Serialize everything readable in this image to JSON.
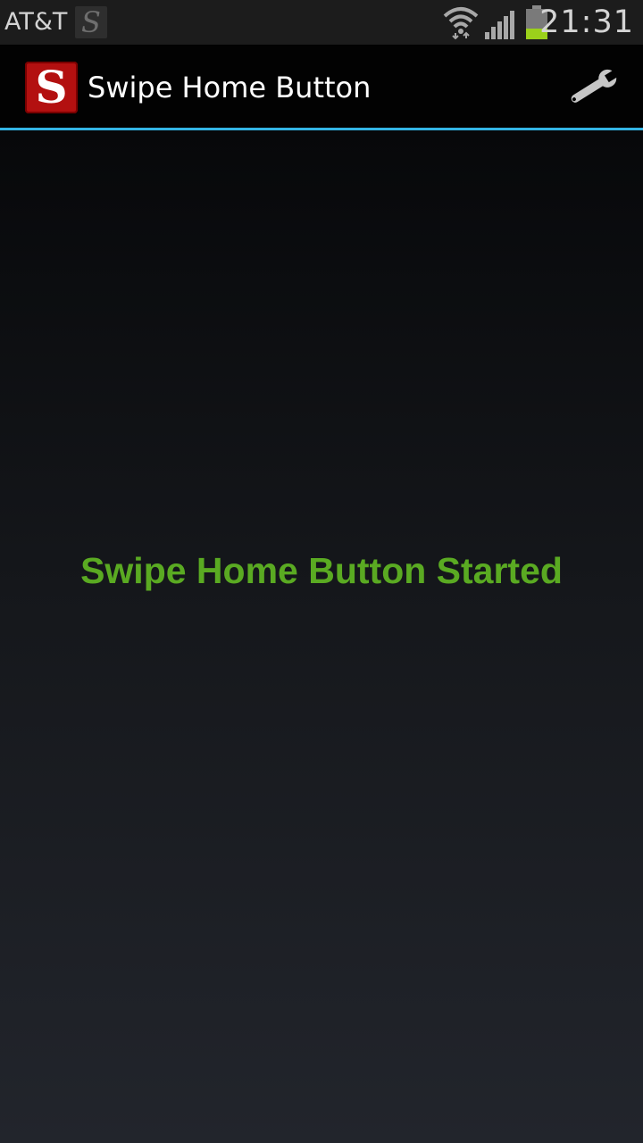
{
  "status_bar": {
    "carrier": "AT&T",
    "notification_icon": "S",
    "time": "21:31",
    "icons": [
      "wifi-icon",
      "signal-icon",
      "battery-icon"
    ]
  },
  "action_bar": {
    "logo_letter": "S",
    "title": "Swipe Home Button",
    "settings_icon": "wrench-icon"
  },
  "main": {
    "status_message": "Swipe Home Button Started"
  },
  "colors": {
    "accent": "#33b5e5",
    "status_message": "#5aaa22",
    "logo_background": "#b31010"
  }
}
